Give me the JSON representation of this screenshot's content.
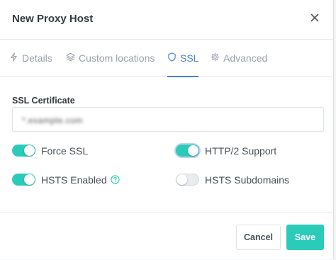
{
  "modal": {
    "title": "New Proxy Host"
  },
  "tabs": [
    {
      "label": "Details",
      "icon": "bolt-icon",
      "active": false
    },
    {
      "label": "Custom locations",
      "icon": "layers-icon",
      "active": false
    },
    {
      "label": "SSL",
      "icon": "shield-icon",
      "active": true
    },
    {
      "label": "Advanced",
      "icon": "gear-icon",
      "active": false
    }
  ],
  "ssl": {
    "certificate_label": "SSL Certificate",
    "certificate_value": "*.example.com",
    "toggles": {
      "force_ssl": {
        "label": "Force SSL",
        "on": true
      },
      "http2": {
        "label": "HTTP/2 Support",
        "on": true
      },
      "hsts_enabled": {
        "label": "HSTS Enabled",
        "on": true
      },
      "hsts_subdomains": {
        "label": "HSTS Subdomains",
        "on": false
      }
    }
  },
  "footer": {
    "cancel_label": "Cancel",
    "save_label": "Save"
  },
  "colors": {
    "accent": "#2bcbba",
    "tab_active": "#467fcf",
    "tab_inactive": "#9aa0ac"
  }
}
